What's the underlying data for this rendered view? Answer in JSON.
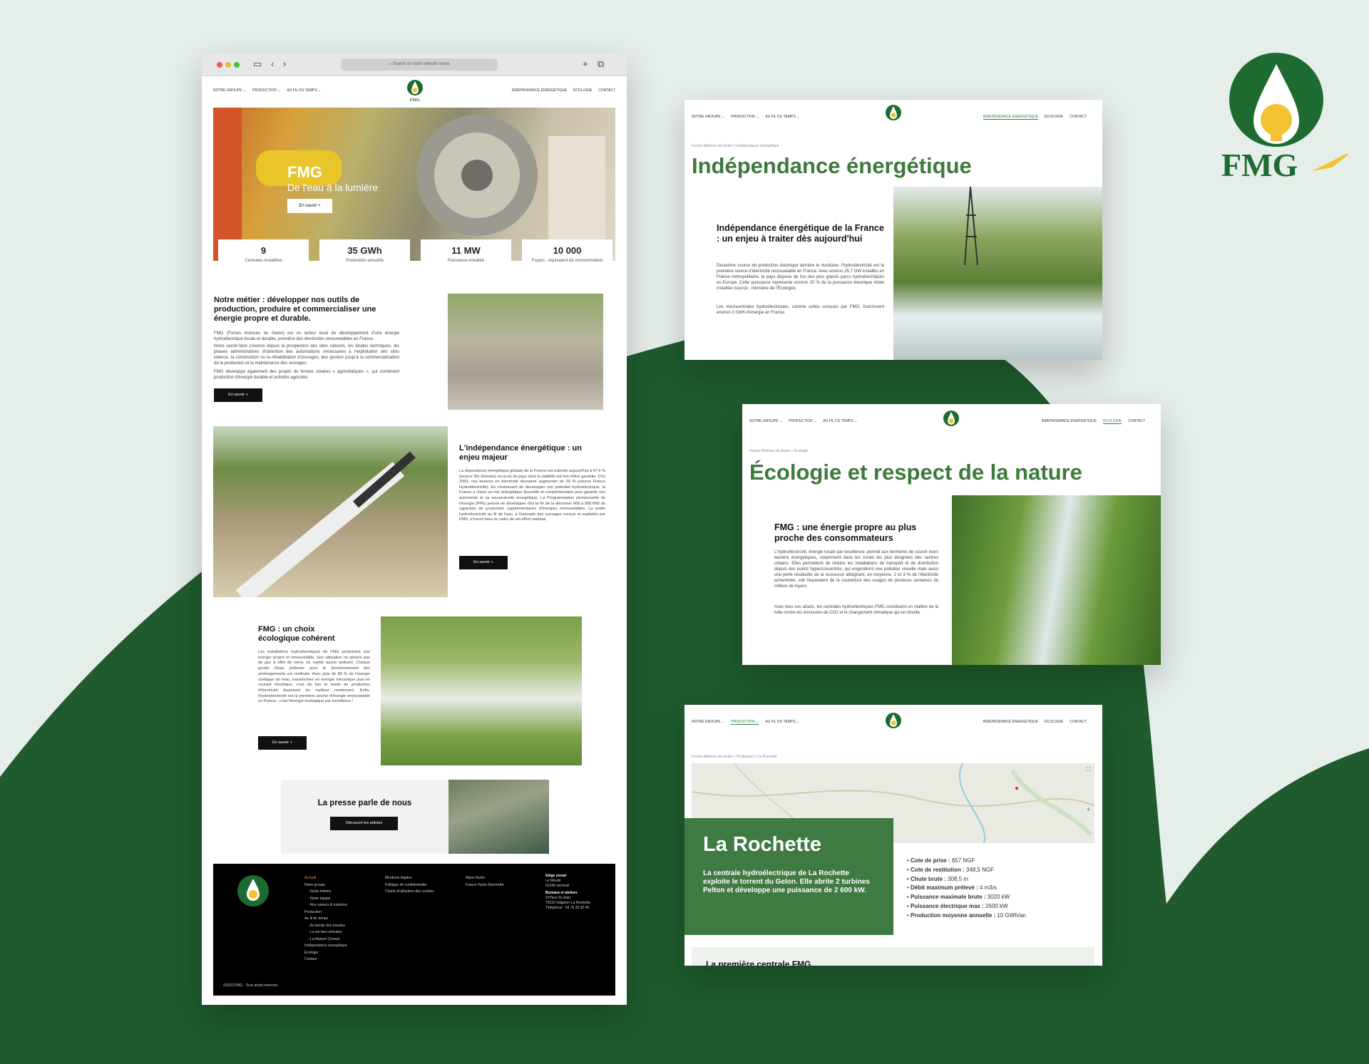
{
  "brand": {
    "name": "FMG"
  },
  "browser": {
    "url_placeholder": "Search or enter website name",
    "nav_left": [
      "NOTRE GROUPE ⌄",
      "PRODUCTION ⌄",
      "AU FIL DU TEMPS ⌄"
    ],
    "nav_right": [
      "INDÉPENDANCE ÉNERGÉTIQUE",
      "ÉCOLOGIE",
      "CONTACT"
    ],
    "logo_text": "FMG",
    "hero": {
      "title": "FMG",
      "subtitle": "De l'eau à la lumière",
      "button": "En savoir +"
    },
    "stats": [
      {
        "value": "9",
        "label": "Centrales installées"
      },
      {
        "value": "35 GWh",
        "label": "Production annuelle"
      },
      {
        "value": "11 MW",
        "label": "Puissance installée"
      },
      {
        "value": "10 000",
        "label": "Foyers : équivalent de consommation"
      }
    ],
    "metier": {
      "title": "Notre métier : développer nos outils de production, produire et commercialiser une énergie propre et durable.",
      "p1": "FMG (Forces motrices du Gelon) est un acteur local du développement d'une énergie hydroélectrique locale et durable, première des électricités renouvelables en France.",
      "p2": "Notre savoir-faire s'exerce depuis la prospection des sites naturels, les études techniques, les phases administratives d'obtention des autorisations nécessaires à l'exploitation des sites retenus, la construction ou la réhabilitation d'ouvrages, leur gestion jusqu'à la commercialisation de la production et la maintenance des ouvrages.",
      "p3": "FMG développe également des projets de fermes solaires « agrivoltaïques », qui combinent production d'énergie durable et activités agricoles.",
      "button": "En savoir +"
    },
    "independance": {
      "title": "L'indépendance énergétique : un enjeu majeur",
      "p": "La dépendance énergétique globale de la France est estimée aujourd'hui à 47,6 %(source We Demain) vis-à-vis de pays dont la stabilité est loin d'être garantie. D'ici 2050, nos besoins en électricité devraient augmenter de 30 % (source France Hydroélectricité). En choisissant de développer son potentiel hydroélectrique, la France a choisi un mix énergétique diversifié et complémentaire pour garantir son autonomie et sa souveraineté énergétique. La Programmation pluriannuelle de l'énergie (PPE) prévoit de développer d'ici la fin de la décennie 668 à 968 MW de capacités de production supplémentaires d'énergies renouvelables. La petite hydroélectricité au fil de l'eau, à l'exemple des ouvrages conçus et exploités par FMG, s'inscrit dans le cadre de cet effort national.",
      "button": "En savoir +"
    },
    "choix": {
      "title": "FMG : un choix écologique cohérent",
      "p": "Les installations hydroélectriques de FMG produisent une énergie propre et renouvelable. Son utilisation ne génère pas de gaz à effet de serre, ne rejette aucun polluant. Chaque goutte d'eau prélevée pour le fonctionnement des aménagements est restituée. Avec plus de 80 % de l'énergie cinétique de l'eau, transformée en énergie mécanique puis en courant électrique, c'est de loin le mode de production d'électricité disposant du meilleur rendement. Enfin, l'hydroélectricité est la première source d'énergie renouvelable en France : c'est l'énergie écologique par excellence !",
      "button": "En savoir +"
    },
    "presse": {
      "title": "La presse parle de nous",
      "button": "Découvrir les articles"
    },
    "footer": {
      "col1": [
        "Accueil",
        "Notre groupe",
        "- Notre histoire",
        "- Notre équipe",
        "- Nos valeurs & missions",
        "Production",
        "Au fil du temps",
        "- Au temps des moulins",
        "- La vie des centrales",
        "- La Maison Conseil",
        "Indépendance énergétique",
        "Écologie",
        "Contact"
      ],
      "col2": [
        "Mentions légales",
        "Politique de confidentialité",
        "Charte d'utilisation des cookies"
      ],
      "col3": [
        "Alpes Hydro",
        "France Hydro Électricité"
      ],
      "col4": [
        "Siège social",
        "Le Moulin",
        "01340 Verneuil",
        "Bureaux et ateliers",
        "9 Place St Jean",
        "73110 Valgelon-La Rochette",
        "Téléphone : 04 79 25 32 40"
      ],
      "copyright": "©2023 FMG - Tous droits réservés"
    }
  },
  "card1": {
    "breadcrumb": "Forces Motrices du Gelon  >  Indépendance énergétique",
    "title": "Indépendance énergétique",
    "subtitle": "Indépendance énergétique de la France : un enjeu à traiter dès aujourd'hui",
    "p1": "Deuxième source de production électrique derrière le nucléaire, l'hydroélectricité est la première source d'électricité renouvelable en France. Avec environ 25,7 GW installés en France métropolitaine, le pays dispose de l'un des plus grands parcs hydroélectriques en Europe. Cette puissance représente environ 20 % de la puissance électrique totale installée (source : ministère de l'Écologie).",
    "p2": "Les microcentrales hydroélectriques, comme celles conçues par FMG, fournissent environ 2 GWh d'énergie en France."
  },
  "card2": {
    "breadcrumb": "Forces Motrices du Gelon  >  Écologie",
    "title": "Écologie et respect de la nature",
    "subtitle": "FMG : une énergie propre au plus proche des consommateurs",
    "p1": "L'hydroélectricité, énergie locale par excellence, permet aux territoires de couvrir leurs besoins énergétiques, notamment dans les zones les plus éloignées des centres urbains. Elles permettent de réduire les installations de transport et de distribution depuis des points hyperconcentrés, qui engendrent une pollution visuelle mais aussi une perte résiduelle de la ressource atteignant, en moyenne, 2 et 3 % de l'électricité acheminée, soit l'équivalent de la couverture des usages de plusieurs centaines de milliers de foyers.",
    "p2": "Avec tous ces atouts, les centrales hydroélectriques FMG constituent un maillon de la lutte contre les émissions de CO2 et le changement climatique qui en résulte."
  },
  "card3": {
    "breadcrumb": "Forces Motrices du Gelon  >  Production  >  La Rochette",
    "title": "La Rochette",
    "desc": "La centrale hydroélectrique de La Rochette exploite le torrent du Gelon. Elle abrite 2 turbines Pelton et développe une puissance de 2 600 kW.",
    "specs": [
      {
        "k": "Cote de prise :",
        "v": "657 NGF"
      },
      {
        "k": "Cote de restitution :",
        "v": "348,5 NGF"
      },
      {
        "k": "Chute brute :",
        "v": "308,5 m"
      },
      {
        "k": "Débit maximum prélevé :",
        "v": "4 m3/s"
      },
      {
        "k": "Puissance maximale brute :",
        "v": "3020 kW"
      },
      {
        "k": "Puissance électrique max :",
        "v": "2600 kW"
      },
      {
        "k": "Production moyenne annuelle :",
        "v": "10 GWh/an"
      }
    ],
    "next_title": "La première centrale FMG"
  },
  "colors": {
    "green": "#1e5e30",
    "accent": "#3d7a3b",
    "bg": "#e6eeea",
    "footer": "#000000"
  }
}
